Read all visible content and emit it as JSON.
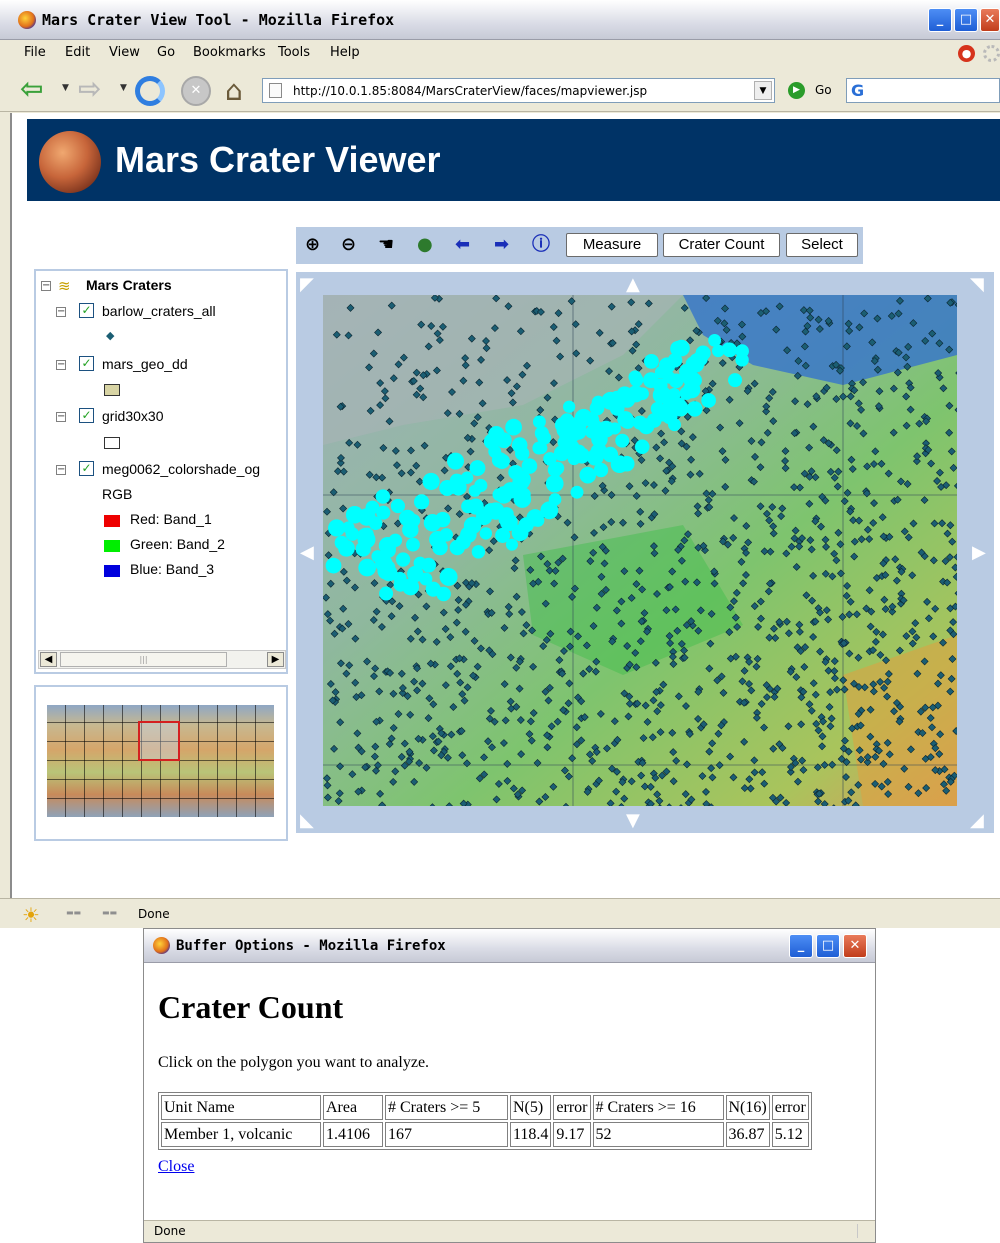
{
  "colors": {
    "banner_bg": "#003366",
    "panel_border": "#b9cbe3",
    "link": "#0000ee",
    "crater_marker": "#1b5e73",
    "selected_crater_marker": "#00ffff"
  },
  "browser": {
    "title": "Mars Crater View Tool - Mozilla Firefox",
    "menu": [
      "File",
      "Edit",
      "View",
      "Go",
      "Bookmarks",
      "Tools",
      "Help"
    ],
    "url": "http://10.0.1.85:8084/MarsCraterView/faces/mapviewer.jsp",
    "go_label": "Go",
    "status": "Done",
    "window_buttons": {
      "minimize": "_",
      "maximize": "□",
      "close": "✕"
    }
  },
  "page": {
    "title": "Mars Crater Viewer",
    "toolbar": {
      "icons": [
        "zoom-in-icon",
        "zoom-out-icon",
        "pan-hand-icon",
        "full-extent-globe-icon",
        "back-arrow-icon",
        "forward-arrow-icon",
        "info-icon"
      ],
      "buttons": {
        "measure": "Measure",
        "crater_count": "Crater Count",
        "select": "Select"
      }
    },
    "toc": {
      "root": "Mars Craters",
      "layers": [
        {
          "name": "barlow_craters_all",
          "checked": true,
          "symbol": "diamond"
        },
        {
          "name": "mars_geo_dd",
          "checked": true,
          "symbol": "tan-box"
        },
        {
          "name": "grid30x30",
          "checked": true,
          "symbol": "hollow-box"
        },
        {
          "name": "meg0062_colorshade_og",
          "checked": true,
          "symbol": "rgb"
        }
      ],
      "rgb_label": "RGB",
      "bands": [
        {
          "label": "Red: Band_1",
          "color": "#ee0000"
        },
        {
          "label": "Green: Band_2",
          "color": "#00ee00"
        },
        {
          "label": "Blue: Band_3",
          "color": "#0000dd"
        }
      ]
    }
  },
  "popup": {
    "title": "Buffer Options - Mozilla Firefox",
    "heading": "Crater Count",
    "instruction": "Click on the polygon you want to analyze.",
    "table": {
      "headers": [
        "Unit Name",
        "Area",
        "# Craters >= 5",
        "N(5)",
        "error",
        "# Craters >= 16",
        "N(16)",
        "error"
      ],
      "rows": [
        [
          "Member 1, volcanic",
          "1.4106",
          "167",
          "118.4",
          "9.17",
          "52",
          "36.87",
          "5.12"
        ]
      ]
    },
    "close_link": "Close",
    "status": "Done"
  }
}
